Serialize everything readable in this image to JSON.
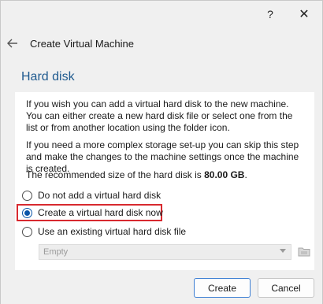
{
  "titlebar": {
    "help_label": "?",
    "close_label": "✕"
  },
  "header": {
    "title": "Create Virtual Machine"
  },
  "section": {
    "title": "Hard disk"
  },
  "content": {
    "para1": "If you wish you can add a virtual hard disk to the new machine. You can either create a new hard disk file or select one from the list or from another location using the folder icon.",
    "para2": "If you need a more complex storage set-up you can skip this step and make the changes to the machine settings once the machine is created.",
    "para3_prefix": "The recommended size of the hard disk is ",
    "para3_size": "80.00 GB",
    "para3_suffix": "."
  },
  "options": [
    {
      "label": "Do not add a virtual hard disk",
      "checked": false
    },
    {
      "label": "Create a virtual hard disk now",
      "checked": true
    },
    {
      "label": "Use an existing virtual hard disk file",
      "checked": false
    }
  ],
  "existing_disk": {
    "selected": "Empty"
  },
  "footer": {
    "create_label": "Create",
    "cancel_label": "Cancel"
  },
  "colors": {
    "highlight": "#d8292f",
    "section_title": "#1f5a8f",
    "radio_checked": "#0a55a8"
  }
}
